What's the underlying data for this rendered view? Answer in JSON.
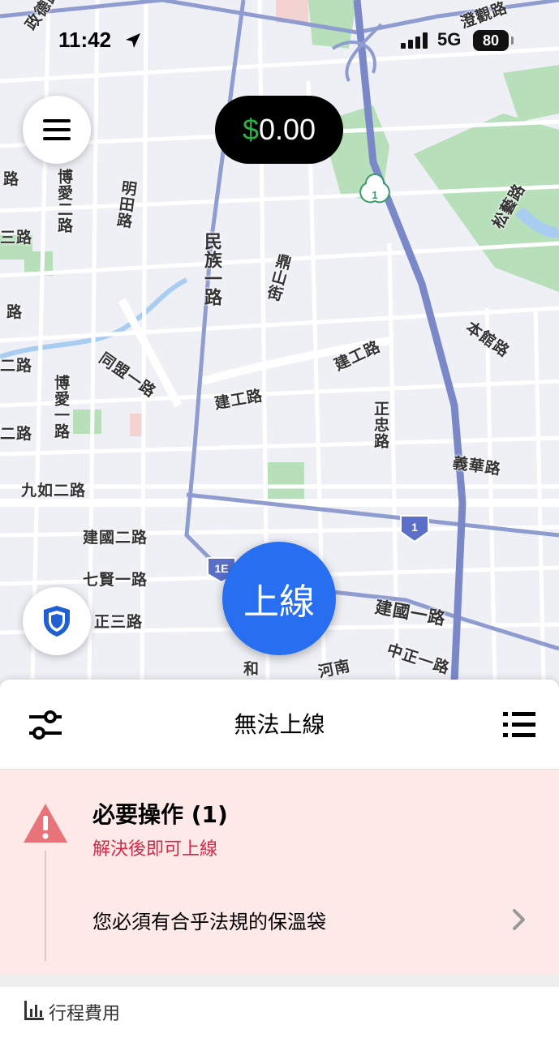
{
  "status_bar": {
    "time": "11:42",
    "network": "5G",
    "battery": "80"
  },
  "earnings": {
    "currency": "$",
    "amount": "0.00"
  },
  "go_button": {
    "label": "上線"
  },
  "map": {
    "labels": [
      "政德路",
      "澄觀路",
      "民族一路",
      "鼎山街",
      "松藝路",
      "本館路",
      "建工路",
      "建工路",
      "正忠路",
      "義華路",
      "九如二路",
      "建國二路",
      "七賢一路",
      "正三路",
      "建國一路",
      "中正一路",
      "河南",
      "同盟一路",
      "博愛二路",
      "博愛一路",
      "明田路",
      "三路",
      "二路",
      "二路",
      "路",
      "路",
      "和"
    ],
    "shields": [
      "1",
      "1",
      "1E"
    ]
  },
  "sheet": {
    "title": "無法上線",
    "alert": {
      "title": "必要操作 (1)",
      "subtitle": "解決後即可上線",
      "item": "您必須有合乎法規的保溫袋"
    },
    "trip_section": "行程費用"
  },
  "colors": {
    "accent": "#276ef1",
    "money": "#2db14a",
    "alert_bg": "#fce9e8",
    "alert_text": "#d32a45",
    "warning": "#e8747a"
  }
}
